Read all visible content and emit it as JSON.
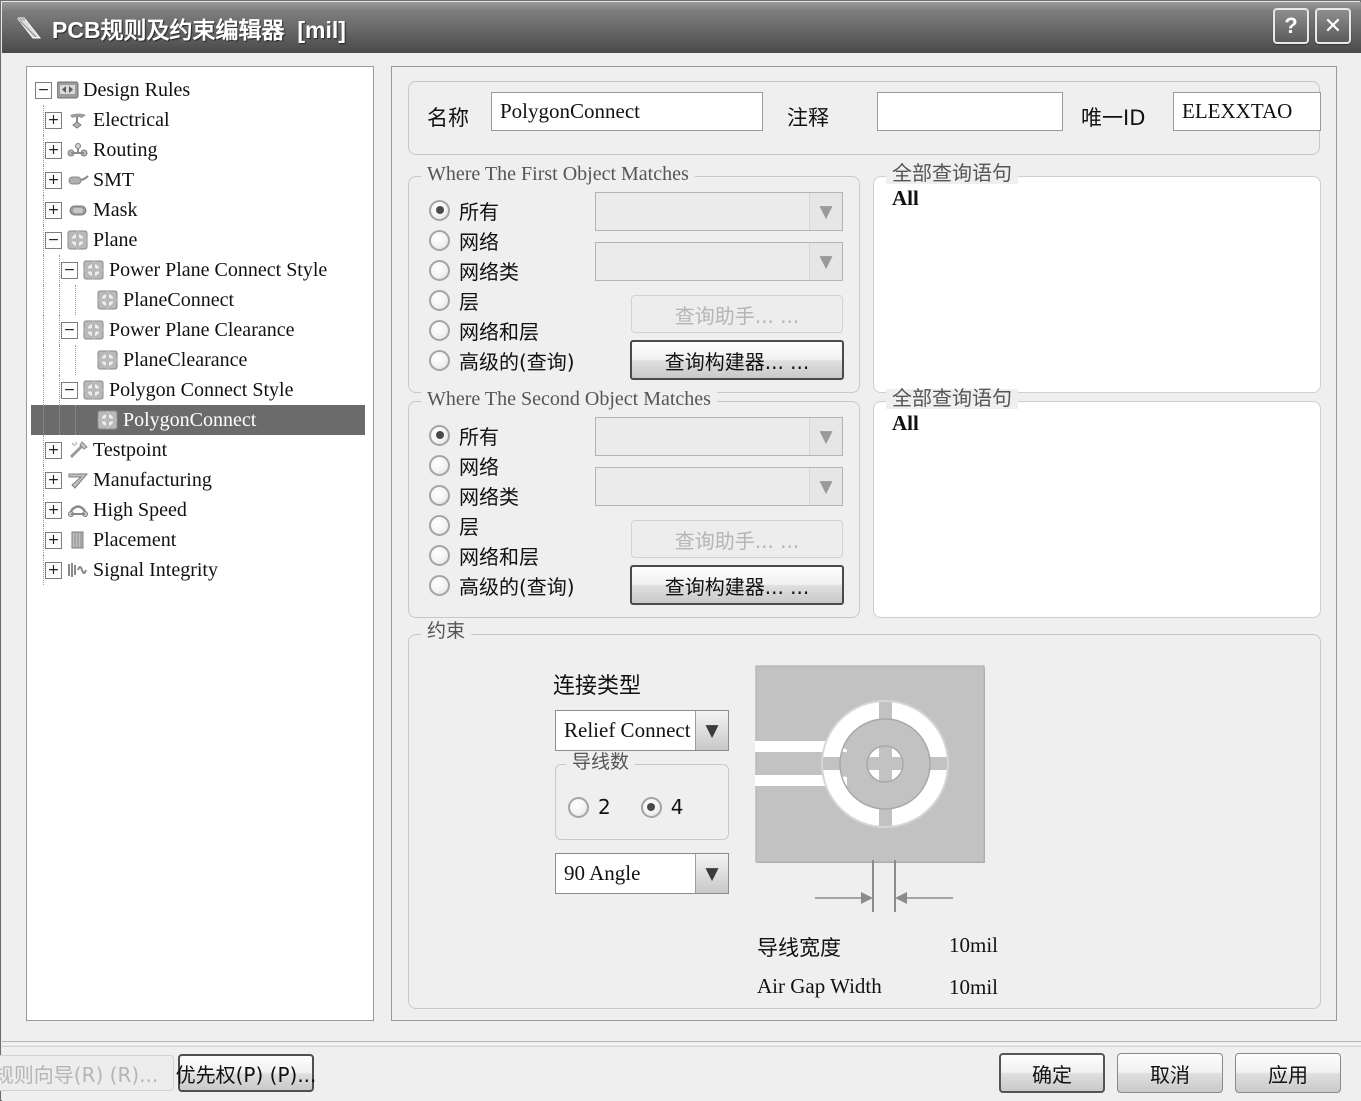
{
  "window": {
    "title": "PCB规则及约束编辑器  [mil]",
    "icon": "pcb-rules-icon",
    "help_button": "?",
    "close_button": "✕"
  },
  "tree": {
    "root_label": "Design Rules",
    "items": [
      {
        "label": "Design Rules",
        "depth": 0,
        "expander": "minus",
        "icon": "design-rules-folder-icon",
        "selected": false
      },
      {
        "label": "Electrical",
        "depth": 1,
        "expander": "plus",
        "icon": "electrical-icon",
        "selected": false
      },
      {
        "label": "Routing",
        "depth": 1,
        "expander": "plus",
        "icon": "routing-icon",
        "selected": false
      },
      {
        "label": "SMT",
        "depth": 1,
        "expander": "plus",
        "icon": "smt-icon",
        "selected": false
      },
      {
        "label": "Mask",
        "depth": 1,
        "expander": "plus",
        "icon": "mask-icon",
        "selected": false
      },
      {
        "label": "Plane",
        "depth": 1,
        "expander": "minus",
        "icon": "plane-icon",
        "selected": false
      },
      {
        "label": "Power Plane Connect Style",
        "depth": 2,
        "expander": "minus",
        "icon": "plane-icon",
        "selected": false
      },
      {
        "label": "PlaneConnect",
        "depth": 3,
        "expander": "none",
        "icon": "plane-icon",
        "selected": false
      },
      {
        "label": "Power Plane Clearance",
        "depth": 2,
        "expander": "minus",
        "icon": "plane-icon",
        "selected": false
      },
      {
        "label": "PlaneClearance",
        "depth": 3,
        "expander": "none",
        "icon": "plane-icon",
        "selected": false
      },
      {
        "label": "Polygon Connect Style",
        "depth": 2,
        "expander": "minus",
        "icon": "plane-icon",
        "selected": false
      },
      {
        "label": "PolygonConnect",
        "depth": 3,
        "expander": "none",
        "icon": "plane-icon",
        "selected": true
      },
      {
        "label": "Testpoint",
        "depth": 1,
        "expander": "plus",
        "icon": "testpoint-icon",
        "selected": false
      },
      {
        "label": "Manufacturing",
        "depth": 1,
        "expander": "plus",
        "icon": "manufacturing-icon",
        "selected": false
      },
      {
        "label": "High Speed",
        "depth": 1,
        "expander": "plus",
        "icon": "high-speed-icon",
        "selected": false
      },
      {
        "label": "Placement",
        "depth": 1,
        "expander": "plus",
        "icon": "placement-icon",
        "selected": false
      },
      {
        "label": "Signal Integrity",
        "depth": 1,
        "expander": "plus",
        "icon": "signal-integrity-icon",
        "selected": false
      }
    ]
  },
  "header": {
    "name_label": "名称",
    "name_value": "PolygonConnect",
    "comment_label": "注释",
    "comment_value": "",
    "unique_id_label": "唯一ID",
    "unique_id_value": "ELEXXTAO"
  },
  "first_object": {
    "group_title": "Where The First Object Matches",
    "options": [
      {
        "label": "所有",
        "selected": true
      },
      {
        "label": "网络",
        "selected": false
      },
      {
        "label": "网络类",
        "selected": false
      },
      {
        "label": "层",
        "selected": false
      },
      {
        "label": "网络和层",
        "selected": false
      },
      {
        "label": "高级的(查询)",
        "selected": false
      }
    ],
    "combo1_value": "",
    "combo2_value": "",
    "helper_button": "查询助手... ...",
    "builder_button": "查询构建器... ..."
  },
  "second_object": {
    "group_title": "Where The Second Object Matches",
    "options": [
      {
        "label": "所有",
        "selected": true
      },
      {
        "label": "网络",
        "selected": false
      },
      {
        "label": "网络类",
        "selected": false
      },
      {
        "label": "层",
        "selected": false
      },
      {
        "label": "网络和层",
        "selected": false
      },
      {
        "label": "高级的(查询)",
        "selected": false
      }
    ],
    "combo1_value": "",
    "combo2_value": "",
    "helper_button": "查询助手... ...",
    "builder_button": "查询构建器... ..."
  },
  "query_panels": {
    "first": {
      "title": "全部查询语句",
      "text": "All"
    },
    "second": {
      "title": "全部查询语句",
      "text": "All"
    }
  },
  "constraints": {
    "group_title": "约束",
    "connect_type_label": "连接类型",
    "connect_type_value": "Relief Connect",
    "conductors_group_title": "导线数",
    "conductor_options": [
      {
        "label": "2",
        "selected": false
      },
      {
        "label": "4",
        "selected": true
      }
    ],
    "angle_value": "90 Angle",
    "conductor_width_label": "导线宽度",
    "conductor_width_value": "10mil",
    "air_gap_label": "Air Gap Width",
    "air_gap_value": "10mil"
  },
  "footer": {
    "rule_wizard_button": "规则向导(R) (R)...",
    "priority_button": "优先权(P) (P)...",
    "ok_button": "确定",
    "cancel_button": "取消",
    "apply_button": "应用"
  },
  "colors": {
    "titlebar": "#6b6b6b",
    "selection": "#6b6b6b",
    "dialog_bg": "#efefef",
    "pad_copper": "#c0c0c0"
  }
}
